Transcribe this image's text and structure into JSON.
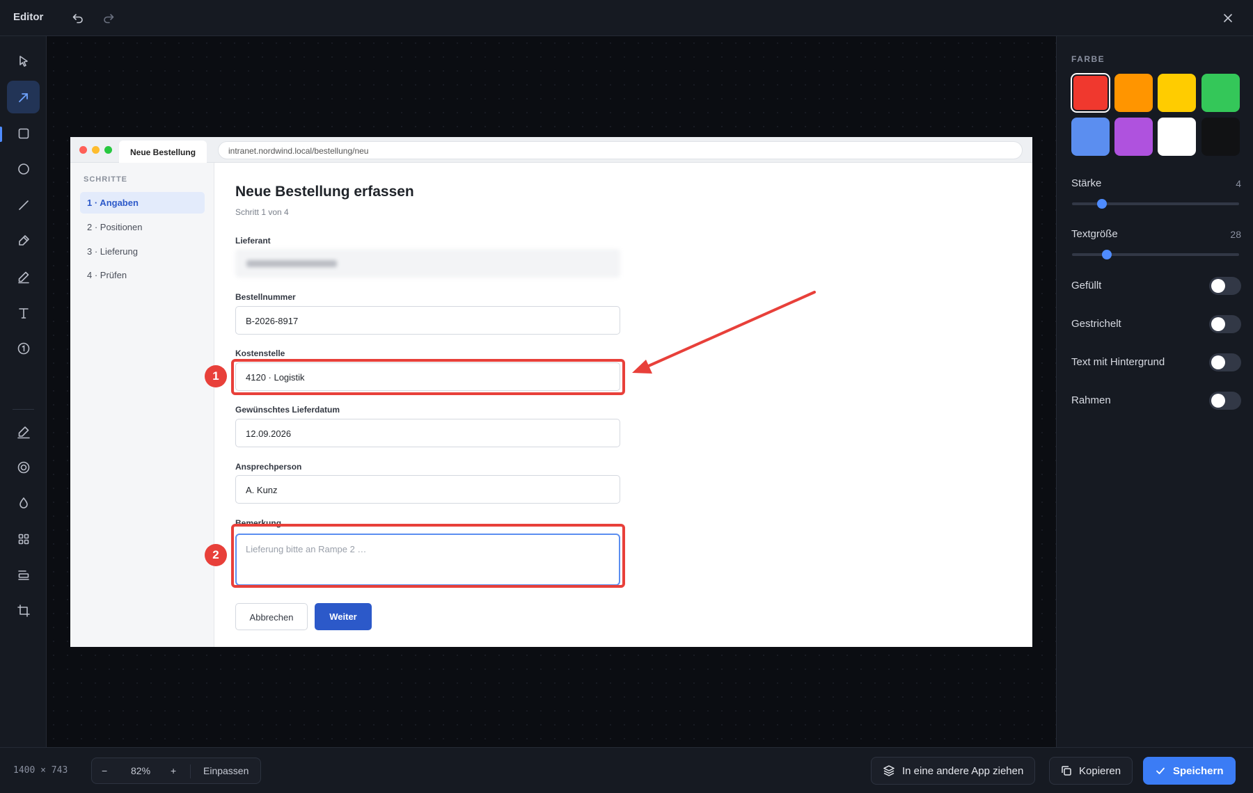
{
  "editor": {
    "title": "Editor",
    "undo_icon": "undo-icon",
    "redo_icon": "redo-icon",
    "close_icon": "close-icon"
  },
  "tools": [
    {
      "name": "select",
      "icon": "cursor-icon"
    },
    {
      "name": "arrow",
      "icon": "arrow-icon",
      "active": true
    },
    {
      "name": "rectangle",
      "icon": "square-icon"
    },
    {
      "name": "ellipse",
      "icon": "circle-icon"
    },
    {
      "name": "line",
      "icon": "line-icon"
    },
    {
      "name": "marker",
      "icon": "marker-icon"
    },
    {
      "name": "pen",
      "icon": "pen-icon"
    },
    {
      "name": "text",
      "icon": "text-icon"
    },
    {
      "name": "counter",
      "icon": "numbered-circle-icon"
    },
    {
      "name": "highlighter",
      "icon": "highlighter-icon"
    },
    {
      "name": "spotlight",
      "icon": "target-icon"
    },
    {
      "name": "blur",
      "icon": "drop-icon"
    },
    {
      "name": "pixelate",
      "icon": "grid-icon"
    },
    {
      "name": "redact",
      "icon": "redact-icon"
    },
    {
      "name": "crop",
      "icon": "crop-icon"
    }
  ],
  "panel": {
    "color_label": "FARBE",
    "swatches": [
      "#f0382e",
      "#ff9500",
      "#ffcc00",
      "#34c759",
      "#5b8ef0",
      "#af52de",
      "#ffffff",
      "#111214"
    ],
    "selected_swatch": "#f0382e",
    "stroke_label": "Stärke",
    "stroke_value": "4",
    "stroke_fraction": 0.16,
    "textsize_label": "Textgröße",
    "textsize_value": "28",
    "textsize_fraction": 0.19,
    "toggles": [
      {
        "label": "Gefüllt",
        "on": false
      },
      {
        "label": "Gestrichelt",
        "on": false
      },
      {
        "label": "Text mit Hintergrund",
        "on": false
      },
      {
        "label": "Rahmen",
        "on": false
      }
    ]
  },
  "bottom": {
    "dimensions": "1400 × 743",
    "zoom_minus": "−",
    "zoom_value": "82%",
    "zoom_plus": "+",
    "fit_label": "Einpassen",
    "drag_label": "In eine andere App ziehen",
    "copy_label": "Kopieren",
    "save_label": "Speichern"
  },
  "screenshot": {
    "tab_title": "Neue Bestellung",
    "url": "intranet.nordwind.local/bestellung/neu",
    "steps_header": "SCHRITTE",
    "steps": [
      "1 · Angaben",
      "2 · Positionen",
      "3 · Lieferung",
      "4 · Prüfen"
    ],
    "form_title": "Neue Bestellung erfassen",
    "form_subtitle": "Schritt 1 von 4",
    "fields": {
      "supplier_label": "Lieferant",
      "order_number_label": "Bestellnummer",
      "order_number_value": "B-2026-8917",
      "cost_center_label": "Kostenstelle",
      "cost_center_value": "4120 · Logistik",
      "delivery_date_label": "Gewünschtes Lieferdatum",
      "delivery_date_value": "12.09.2026",
      "contact_label": "Ansprechperson",
      "contact_value": "A. Kunz",
      "remark_label": "Bemerkung",
      "remark_placeholder": "Lieferung bitte an Rampe 2 …"
    },
    "cancel_label": "Abbrechen",
    "next_label": "Weiter"
  },
  "annotations": {
    "badge_1": "1",
    "badge_2": "2",
    "color": "#e8403a"
  }
}
